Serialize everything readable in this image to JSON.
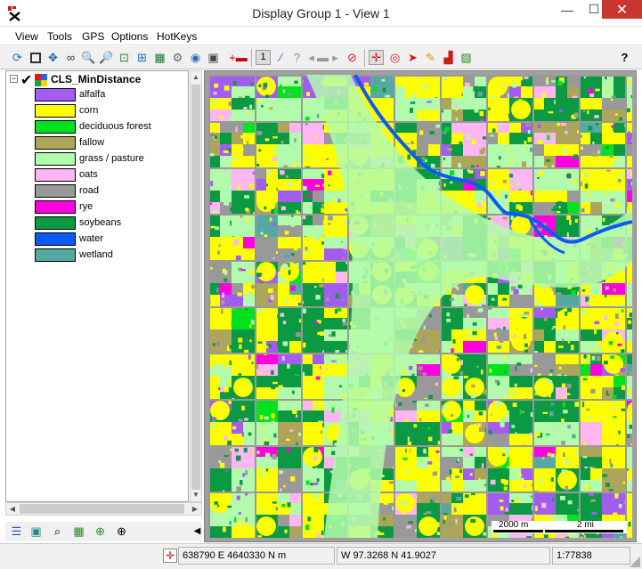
{
  "window": {
    "title": "Display Group 1 - View 1",
    "minimize_glyph": "—",
    "maximize_glyph": "☐",
    "close_glyph": "✕"
  },
  "menu": [
    "View",
    "Tools",
    "GPS",
    "Options",
    "HotKeys"
  ],
  "toolbar": {
    "help_glyph": "?"
  },
  "layer": {
    "name": "CLS_MinDistance",
    "expanded_glyph": "−",
    "checked_glyph": "✔"
  },
  "legend": [
    {
      "label": "alfalfa",
      "color": "#a35cf0"
    },
    {
      "label": "corn",
      "color": "#ffff00"
    },
    {
      "label": "deciduous forest",
      "color": "#00e21d"
    },
    {
      "label": "fallow",
      "color": "#aca55a"
    },
    {
      "label": "grass / pasture",
      "color": "#b3fbac"
    },
    {
      "label": "oats",
      "color": "#ffb6f2"
    },
    {
      "label": "road",
      "color": "#999999"
    },
    {
      "label": "rye",
      "color": "#ff00df"
    },
    {
      "label": "soybeans",
      "color": "#0b9a43"
    },
    {
      "label": "water",
      "color": "#0b5af8"
    },
    {
      "label": "wetland",
      "color": "#56a9a3"
    }
  ],
  "scalebar": {
    "metric_label": "2000 m",
    "imperial_label": "2 mi"
  },
  "status": {
    "utm": "638790 E  4640330 N m",
    "geo": "W 97.3268  N 41.9027",
    "scale": "1:77838"
  }
}
